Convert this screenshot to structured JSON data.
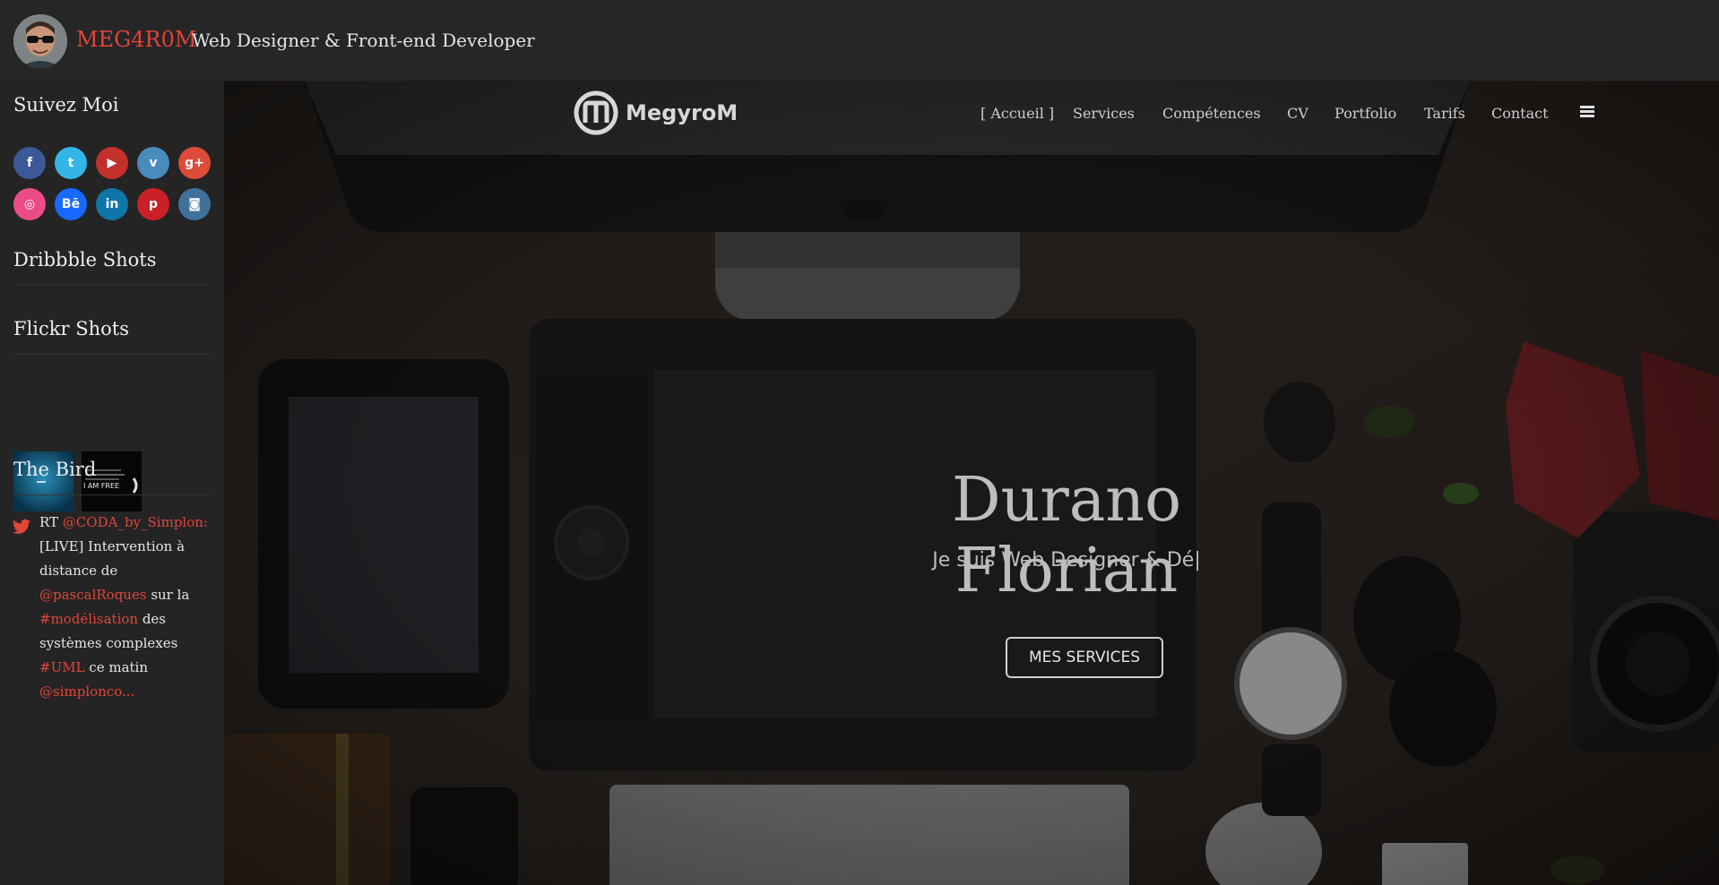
{
  "header": {
    "brand": "MEG4R0M",
    "tagline": "Web Designer & Front-end Developer"
  },
  "sidebar": {
    "follow_title": "Suivez Moi",
    "social": [
      {
        "icon": "facebook-icon",
        "glyph": "f",
        "color": "#3b5998"
      },
      {
        "icon": "twitter-icon",
        "glyph": "t",
        "color": "#33b5e5"
      },
      {
        "icon": "youtube-icon",
        "glyph": "▶",
        "color": "#c4302b"
      },
      {
        "icon": "vimeo-icon",
        "glyph": "v",
        "color": "#4a8bbd"
      },
      {
        "icon": "google-plus-icon",
        "glyph": "g+",
        "color": "#dd4b39"
      },
      {
        "icon": "dribbble-icon",
        "glyph": "◎",
        "color": "#ea4c89"
      },
      {
        "icon": "behance-icon",
        "glyph": "Bē",
        "color": "#1769ff"
      },
      {
        "icon": "linkedin-icon",
        "glyph": "in",
        "color": "#0e76a8"
      },
      {
        "icon": "pinterest-icon",
        "glyph": "p",
        "color": "#cb2027"
      },
      {
        "icon": "instagram-icon",
        "glyph": "◙",
        "color": "#3f729b"
      }
    ],
    "dribbble_title": "Dribbble Shots",
    "flickr_title": "Flickr Shots",
    "flickr_second_text": "I AM FREE",
    "bird_title": "The Bird",
    "tweet": {
      "t1": "RT ",
      "h1": "@CODA_by_Simplon:",
      "t2": " [LIVE] Intervention à distance de ",
      "h2": "@pascalRoques",
      "t3": " sur la ",
      "h3": "#modélisation",
      "t4": " des systèmes complexes ",
      "h4": "#UML",
      "t5": " ce matin ",
      "h5": "@simplonco..."
    }
  },
  "nav": {
    "logo_text": "MegyroM",
    "items": [
      "[ Accueil ]",
      "Services",
      "Compétences",
      "CV",
      "Portfolio",
      "Tarifs",
      "Contact"
    ]
  },
  "hero": {
    "title": "Durano Florian",
    "subtitle": "Je suis Web Designer & Dé|",
    "button": "MES SERVICES"
  },
  "colors": {
    "accent": "#e0463a",
    "background": "#242424"
  }
}
